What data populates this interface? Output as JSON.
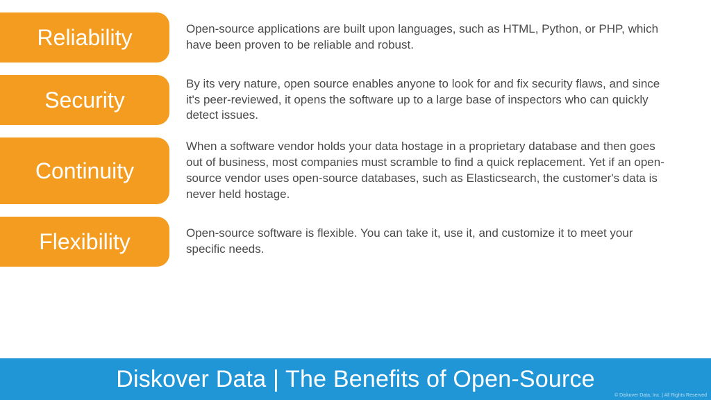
{
  "items": [
    {
      "title": "Reliability",
      "desc": "Open-source applications are built upon languages, such as HTML, Python, or PHP, which have been proven to be reliable and robust."
    },
    {
      "title": "Security",
      "desc": "By its very nature, open source enables anyone to look for and fix security flaws, and since it's peer-reviewed, it opens the software up to a large base of inspectors who can quickly detect issues."
    },
    {
      "title": "Continuity",
      "desc": "When a software vendor holds your data hostage in a proprietary database and then goes out of business, most companies must scramble to find a quick replacement. Yet if an open-source vendor uses open-source databases, such as Elasticsearch, the customer's data is never held hostage."
    },
    {
      "title": "Flexibility",
      "desc": "Open-source software is flexible. You can take it, use it, and customize it to meet your specific needs."
    }
  ],
  "footer": {
    "title": "Diskover Data | The Benefits of Open-Source",
    "copyright": "© Diskover Data, Inc. | All Rights Reserved"
  }
}
